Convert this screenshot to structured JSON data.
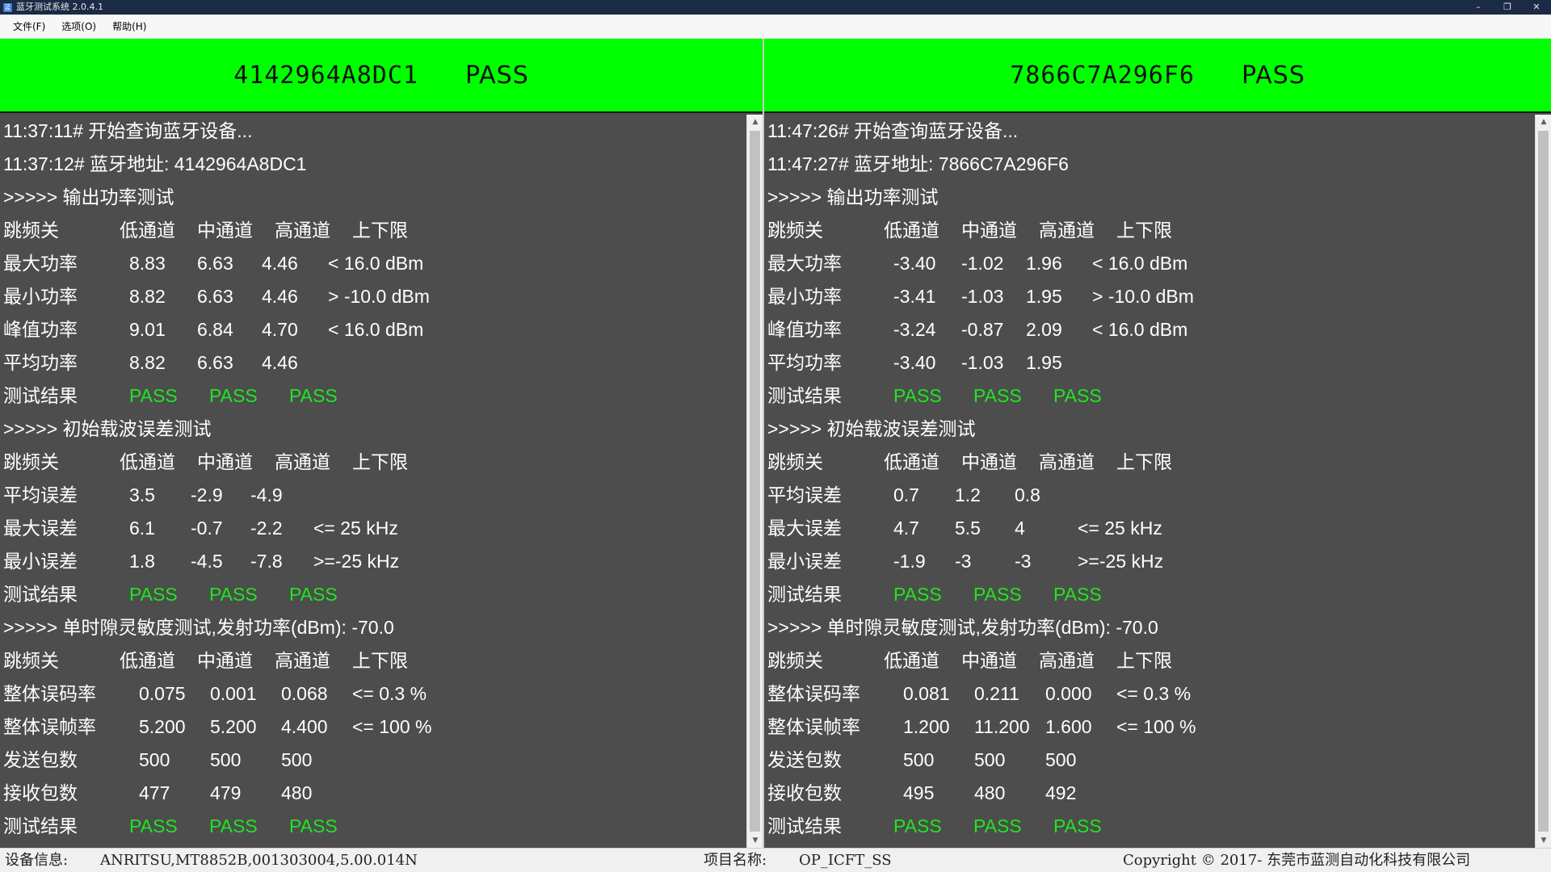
{
  "window": {
    "title": "蓝牙测试系统 2.0.4.1",
    "icon": "app-icon",
    "minimize_label": "–",
    "restore_label": "❐",
    "close_label": "✕"
  },
  "menu": [
    "文件(F)",
    "选项(O)",
    "帮助(H)"
  ],
  "panels": [
    {
      "address": "4142964A8DC1",
      "status": "PASS",
      "header_color": "#00ff00",
      "log": {
        "l0": "11:37:11# 开始查询蓝牙设备...",
        "l1": "11:37:12# 蓝牙地址: 4142964A8DC1",
        "s1": ">>>>> 输出功率测试",
        "h1": [
          "跳频关",
          "低通道",
          "中通道",
          "高通道",
          "上下限"
        ],
        "r1": [
          [
            "最大功率",
            "8.83",
            "6.63",
            "4.46",
            "< 16.0 dBm"
          ],
          [
            "最小功率",
            "8.82",
            "6.63",
            "4.46",
            "> -10.0 dBm"
          ],
          [
            "峰值功率",
            "9.01",
            "6.84",
            "4.70",
            "< 16.0 dBm"
          ],
          [
            "平均功率",
            "8.82",
            "6.63",
            "4.46",
            ""
          ]
        ],
        "p1": [
          "测试结果",
          "PASS",
          "PASS",
          "PASS"
        ],
        "s2": ">>>>> 初始载波误差测试",
        "h2": [
          "跳频关",
          "低通道",
          "中通道",
          "高通道",
          "上下限"
        ],
        "r2": [
          [
            "平均误差",
            "3.5",
            "-2.9",
            "-4.9",
            ""
          ],
          [
            "最大误差",
            "6.1",
            "-0.7",
            "-2.2",
            "<= 25 kHz"
          ],
          [
            "最小误差",
            "1.8",
            "-4.5",
            "-7.8",
            ">=-25 kHz"
          ]
        ],
        "p2": [
          "测试结果",
          "PASS",
          "PASS",
          "PASS"
        ],
        "s3": ">>>>> 单时隙灵敏度测试,发射功率(dBm): -70.0",
        "h3": [
          "跳频关",
          "低通道",
          "中通道",
          "高通道",
          "上下限"
        ],
        "r3": [
          [
            "整体误码率",
            "0.075",
            "0.001",
            "0.068",
            "<= 0.3 %"
          ],
          [
            "整体误帧率",
            "5.200",
            "5.200",
            "4.400",
            "<= 100 %"
          ],
          [
            "发送包数",
            "500",
            "500",
            "500",
            ""
          ],
          [
            "接收包数",
            "477",
            "479",
            "480",
            ""
          ]
        ],
        "p3": [
          "测试结果",
          "PASS",
          "PASS",
          "PASS"
        ]
      }
    },
    {
      "address": "7866C7A296F6",
      "status": "PASS",
      "header_color": "#00ff00",
      "log": {
        "l0": "11:47:26# 开始查询蓝牙设备...",
        "l1": "11:47:27# 蓝牙地址: 7866C7A296F6",
        "s1": ">>>>> 输出功率测试",
        "h1": [
          "跳频关",
          "低通道",
          "中通道",
          "高通道",
          "上下限"
        ],
        "r1": [
          [
            "最大功率",
            "-3.40",
            "-1.02",
            "1.96",
            "< 16.0 dBm"
          ],
          [
            "最小功率",
            "-3.41",
            "-1.03",
            "1.95",
            "> -10.0 dBm"
          ],
          [
            "峰值功率",
            "-3.24",
            "-0.87",
            "2.09",
            "< 16.0 dBm"
          ],
          [
            "平均功率",
            "-3.40",
            "-1.03",
            "1.95",
            ""
          ]
        ],
        "p1": [
          "测试结果",
          "PASS",
          "PASS",
          "PASS"
        ],
        "s2": ">>>>> 初始载波误差测试",
        "h2": [
          "跳频关",
          "低通道",
          "中通道",
          "高通道",
          "上下限"
        ],
        "r2": [
          [
            "平均误差",
            "0.7",
            "1.2",
            "0.8",
            ""
          ],
          [
            "最大误差",
            "4.7",
            "5.5",
            "4",
            "<= 25 kHz"
          ],
          [
            "最小误差",
            "-1.9",
            "-3",
            "-3",
            ">=-25 kHz"
          ]
        ],
        "p2": [
          "测试结果",
          "PASS",
          "PASS",
          "PASS"
        ],
        "s3": ">>>>> 单时隙灵敏度测试,发射功率(dBm): -70.0",
        "h3": [
          "跳频关",
          "低通道",
          "中通道",
          "高通道",
          "上下限"
        ],
        "r3": [
          [
            "整体误码率",
            "0.081",
            "0.211",
            "0.000",
            "<= 0.3 %"
          ],
          [
            "整体误帧率",
            "1.200",
            "11.200",
            "1.600",
            "<= 100 %"
          ],
          [
            "发送包数",
            "500",
            "500",
            "500",
            ""
          ],
          [
            "接收包数",
            "495",
            "480",
            "492",
            ""
          ]
        ],
        "p3": [
          "测试结果",
          "PASS",
          "PASS",
          "PASS"
        ]
      }
    }
  ],
  "status_bar": {
    "device_label": "设备信息:",
    "device_value": "ANRITSU,MT8852B,001303004,5.00.014N",
    "project_label": "项目名称:",
    "project_value": "OP_ICFT_SS",
    "copyright": "Copyright © 2017- 东莞市蓝测自动化科技有限公司"
  },
  "colors": {
    "pass_text": "#1ee61e",
    "log_background": "#4d4d4d",
    "header_background": "#00ff00"
  }
}
